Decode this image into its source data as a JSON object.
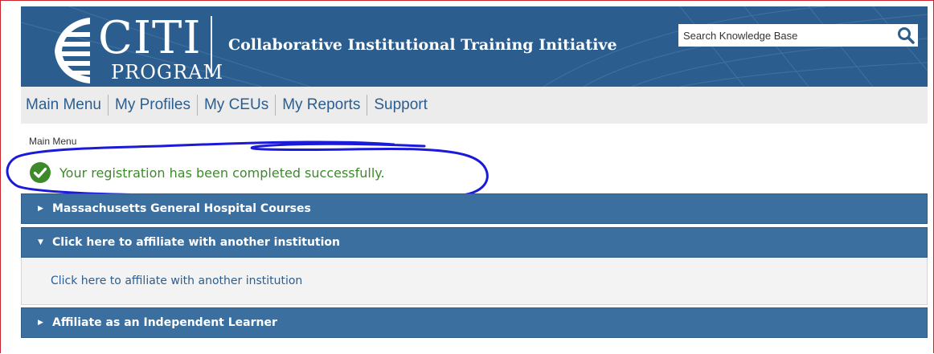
{
  "header": {
    "logo_main": "CITI",
    "logo_sub": "PROGRAM",
    "tagline": "Collaborative Institutional Training Initiative",
    "search_placeholder": "Search Knowledge Base",
    "icons": {
      "search": "search-icon",
      "logo": "citi-globe-icon"
    }
  },
  "nav": {
    "items": [
      {
        "label": "Main Menu"
      },
      {
        "label": "My Profiles"
      },
      {
        "label": "My CEUs"
      },
      {
        "label": "My Reports"
      },
      {
        "label": "Support"
      }
    ]
  },
  "breadcrumb": "Main Menu",
  "alert": {
    "text": "Your registration has been completed successfully.",
    "icon": "check-circle-icon",
    "color": "#3c8a2a"
  },
  "panels": [
    {
      "title": "Massachusetts General Hospital Courses",
      "expanded": false
    },
    {
      "title": "Click here to affiliate with another institution",
      "expanded": true,
      "body_link": "Click here to affiliate with another institution"
    },
    {
      "title": "Affiliate as an Independent Learner",
      "expanded": false
    }
  ],
  "colors": {
    "brand_blue": "#2b5e8f",
    "panel_blue": "#3a6f9f",
    "annotation": "#1a1ad8"
  }
}
